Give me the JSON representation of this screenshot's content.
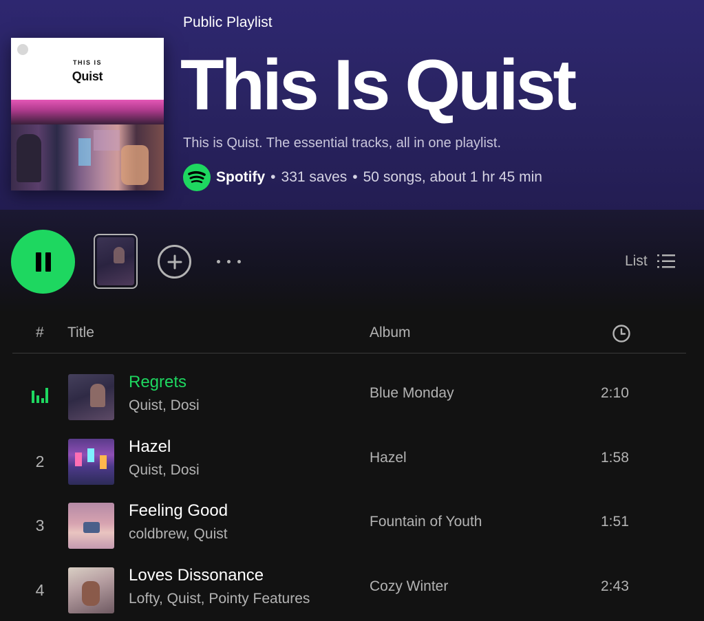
{
  "playlist": {
    "type_label": "Public Playlist",
    "title": "This Is Quist",
    "description": "This is Quist. The essential tracks, all in one playlist.",
    "owner": "Spotify",
    "saves": "331 saves",
    "length": "50 songs, about 1 hr 45 min",
    "separator": "•",
    "cover": {
      "small_text": "THIS IS",
      "name": "Quist"
    }
  },
  "actions": {
    "view_label": "List"
  },
  "table": {
    "headers": {
      "number": "#",
      "title": "Title",
      "album": "Album"
    },
    "rows": [
      {
        "number": "1",
        "title": "Regrets",
        "artists": "Quist, Dosi",
        "album": "Blue Monday",
        "duration": "2:10",
        "playing": true
      },
      {
        "number": "2",
        "title": "Hazel",
        "artists": "Quist, Dosi",
        "album": "Hazel",
        "duration": "1:58",
        "playing": false
      },
      {
        "number": "3",
        "title": "Feeling Good",
        "artists": "coldbrew, Quist",
        "album": "Fountain of Youth",
        "duration": "1:51",
        "playing": false
      },
      {
        "number": "4",
        "title": "Loves Dissonance",
        "artists": "Lofty, Quist, Pointy Features",
        "album": "Cozy Winter",
        "duration": "2:43",
        "playing": false
      }
    ]
  },
  "colors": {
    "accent": "#1ed760",
    "header_bg": "#2a2463",
    "page_bg": "#121212",
    "muted_text": "#b3b3b3"
  },
  "icons": {
    "play_button": "pause-icon",
    "add": "add-circle-icon",
    "more": "more-options-icon",
    "view": "list-view-icon",
    "duration_header": "clock-icon",
    "now_playing": "equalizer-icon",
    "owner_logo": "spotify-logo-icon"
  }
}
